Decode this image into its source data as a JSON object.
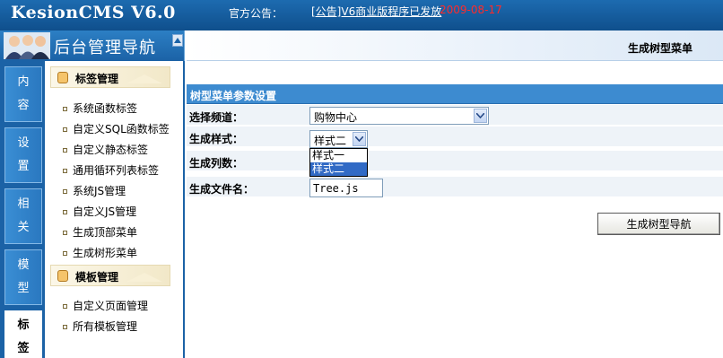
{
  "header": {
    "logo": "KesionCMS V6.0",
    "notice_label": "官方公告：",
    "notice_link": "[公告]V6商业版程序已发放",
    "notice_date": "2009-08-17",
    "colors": {
      "bar": "#1d6bb0",
      "date": "#ff2a2a"
    }
  },
  "sidebar": {
    "title": "后台管理导航",
    "tabs": [
      {
        "label": "内\n容",
        "active": false
      },
      {
        "label": "设\n置",
        "active": false
      },
      {
        "label": "相\n关",
        "active": false
      },
      {
        "label": "模\n型",
        "active": false
      },
      {
        "label": "标\n签",
        "active": true
      }
    ],
    "sections": [
      {
        "title": "标签管理",
        "items": [
          "系统函数标签",
          "自定义SQL函数标签",
          "自定义静态标签",
          "通用循环列表标签",
          "系统JS管理",
          "自定义JS管理",
          "生成顶部菜单",
          "生成树形菜单"
        ]
      },
      {
        "title": "模板管理",
        "items": [
          "自定义页面管理",
          "所有模板管理"
        ]
      }
    ]
  },
  "main": {
    "page_title": "生成树型菜单",
    "panel_title": "树型菜单参数设置",
    "fields": {
      "channel": {
        "label": "选择频道：",
        "value": "购物中心"
      },
      "style": {
        "label": "生成样式：",
        "value": "样式二",
        "options": [
          "样式一",
          "样式二"
        ],
        "selected_index": 1
      },
      "columns": {
        "label": "生成列数："
      },
      "filename": {
        "label": "生成文件名：",
        "value": "Tree.js"
      }
    },
    "submit_label": "生成树型导航"
  }
}
